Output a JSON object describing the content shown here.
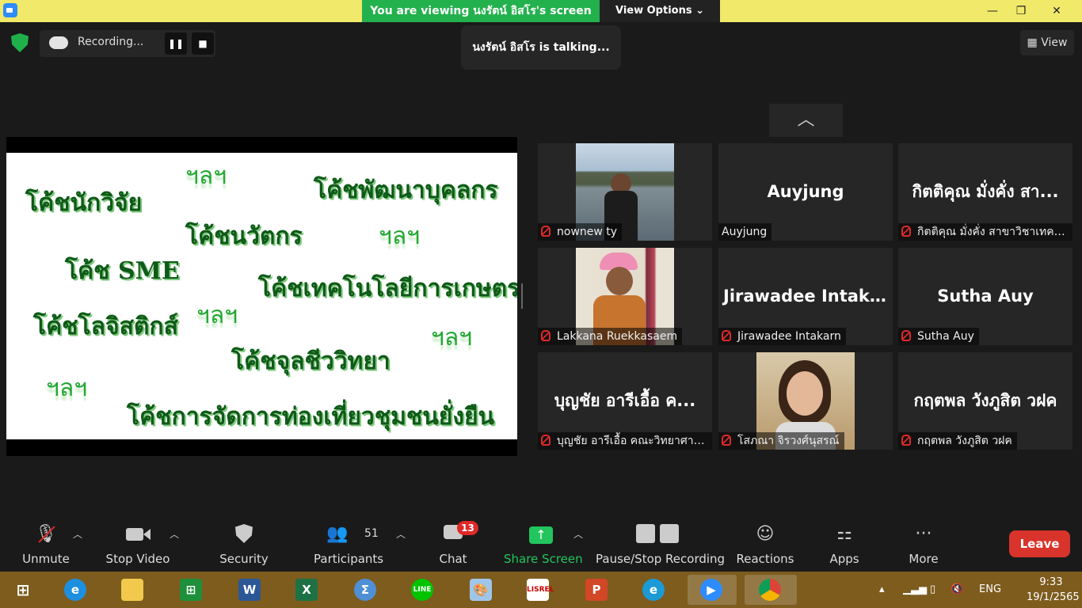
{
  "topbar": {
    "viewing": "You are viewing นงรัตน์ อิสโร's screen",
    "view_options": "View Options ⌄",
    "minimize": "—",
    "maximize": "❐",
    "close": "✕"
  },
  "recording": {
    "label": "Recording...",
    "pause_icon": "❚❚",
    "stop_icon": "■"
  },
  "talking": "นงรัตน์ อิสโร is talking...",
  "view_button": "View",
  "slide": {
    "items": [
      "โค้ชนักวิจัย",
      "โค้ชพัฒนาบุคลกร",
      "โค้ชนวัตกร",
      "โค้ช SME",
      "โค้ชเทคโนโลยีการเกษตร",
      "โค้ชโลจิสติกส์",
      "โค้ชจุลชีววิทยา",
      "โค้ชการจัดการท่องเที่ยวชุมชนยั่งยืน"
    ],
    "etc": [
      "ฯลฯ",
      "ฯลฯ",
      "ฯลฯ",
      "ฯลฯ",
      "ฯลฯ"
    ]
  },
  "participants": [
    {
      "big": "",
      "name": "nownew ty",
      "muted": true
    },
    {
      "big": "Auyjung",
      "name": "Auyjung",
      "muted": false
    },
    {
      "big": "กิตติคุณ  มั่งคั่ง สา...",
      "name": "กิตติคุณ  มั่งคั่ง สาขาวิชาเทคโ...",
      "muted": true
    },
    {
      "big": "",
      "name": "Lakkana Ruekkasaem",
      "muted": true
    },
    {
      "big": "Jirawadee  Intak...",
      "name": "Jirawadee Intakarn",
      "muted": true
    },
    {
      "big": "Sutha Auy",
      "name": "Sutha Auy",
      "muted": true
    },
    {
      "big": "บุญชัย  อารีเอื้อ  ค...",
      "name": "บุญชัย อารีเอื้อ คณะวิทยาศาส...",
      "muted": true
    },
    {
      "big": "",
      "name": "โสภณา จิรวงศ์นุสรณ์",
      "muted": true
    },
    {
      "big": "กฤตพล  วังภูสิต  วฝค",
      "name": "กฤตพล วังภูสิต วฝค",
      "muted": true
    }
  ],
  "toolbar": {
    "unmute": "Unmute",
    "stop_video": "Stop Video",
    "security": "Security",
    "participants": "Participants",
    "participants_count": "51",
    "chat": "Chat",
    "chat_badge": "13",
    "share_screen": "Share Screen",
    "pause_stop": "Pause/Stop Recording",
    "reactions": "Reactions",
    "apps": "Apps",
    "more": "More",
    "leave": "Leave"
  },
  "taskbar": {
    "lang": "ENG",
    "time": "9:33",
    "date": "19/1/2565"
  },
  "colors": {
    "share_green": "#22c55e",
    "leave_red": "#d9342b",
    "banner_yellow": "#f0e96a",
    "banner_green": "#23b14d"
  }
}
